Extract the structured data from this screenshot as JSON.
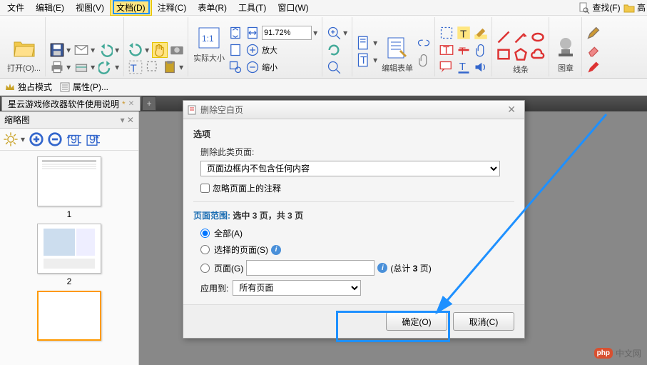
{
  "menu": {
    "file": "文件",
    "edit": "编辑(E)",
    "view": "视图(V)",
    "document": "文档(D)",
    "comments": "注释(C)",
    "forms": "表单(R)",
    "tools": "工具(T)",
    "window": "窗口(W)",
    "find": "查找(F)",
    "high": "高"
  },
  "ribbon": {
    "open": "打开(O)...",
    "actual_size": "实际大小",
    "zoom_in": "放大",
    "zoom_out": "缩小",
    "zoom_value": "91.72%",
    "edit_form": "编辑表单",
    "lines": "线条",
    "stamp": "图章"
  },
  "propbar": {
    "exclusive": "独占模式",
    "properties": "属性(P)..."
  },
  "tab": {
    "title": "星云游戏修改器软件使用说明"
  },
  "sidepanel": {
    "title": "缩略图",
    "pages": [
      "1",
      "2"
    ]
  },
  "dialog": {
    "title": "删除空白页",
    "options_header": "选项",
    "delete_label": "删除此类页面:",
    "delete_option": "页面边框内不包含任何内容",
    "ignore_comments": "忽略页面上的注释",
    "range_prefix": "页面范围: ",
    "range_text_a": "选中 ",
    "range_text_b": " 页，共 ",
    "range_text_c": " 页",
    "range_selected": "3",
    "range_total": "3",
    "radio_all": "全部(A)",
    "radio_selected": "选择的页面(S)",
    "radio_pages": "页面(G)",
    "total_hint_a": "(总计 ",
    "total_hint_b": " 页)",
    "total_hint_n": "3",
    "apply_label": "应用到:",
    "apply_option": "所有页面",
    "ok": "确定(O)",
    "cancel": "取消(C)"
  },
  "watermark": {
    "logo": "php",
    "text": "中文网"
  }
}
